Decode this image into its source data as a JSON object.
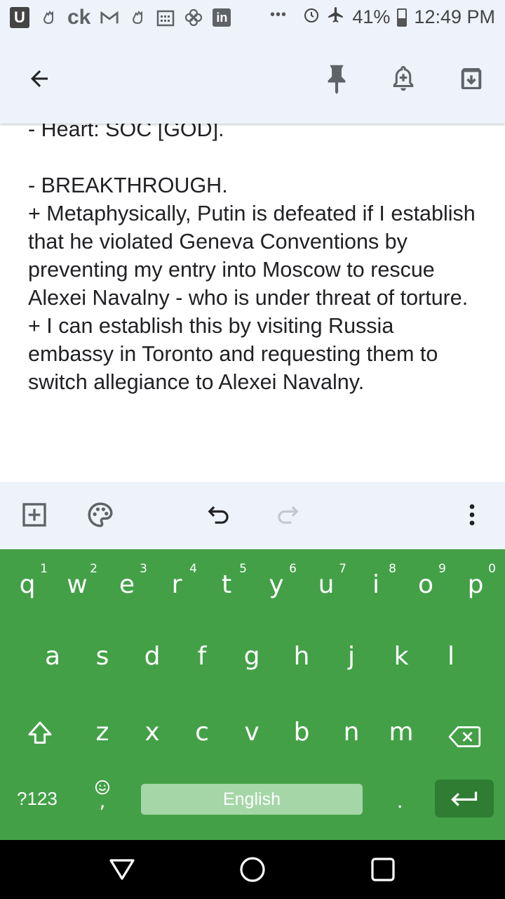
{
  "status_bar": {
    "app_letter": "U",
    "left_text": "ck",
    "right_icons": [
      "alarm-icon",
      "airplane-icon",
      "battery-icon"
    ],
    "battery": "41%",
    "time": "12:49 PM",
    "overflow": "•••"
  },
  "app_bar": {
    "back": "arrow-back-icon",
    "actions": [
      "pin-icon",
      "reminder-bell-icon",
      "archive-icon"
    ]
  },
  "note": {
    "lines": [
      "- Heart: SOC [GOD].",
      "",
      "- BREAKTHROUGH.",
      "+ Metaphysically, Putin is defeated if I establish that he violated Geneva Conventions by preventing my entry into Moscow to rescue Alexei Navalny - who is under threat of torture.",
      "+ I can establish this by visiting Russia embassy in Toronto and requesting them to switch allegiance to Alexei Navalny."
    ]
  },
  "editor_toolbar": {
    "tools": [
      "add-box-icon",
      "palette-icon",
      "undo-icon",
      "redo-icon",
      "more-vert-icon"
    ]
  },
  "keyboard": {
    "row1": [
      {
        "key": "q",
        "hint": "1"
      },
      {
        "key": "w",
        "hint": "2"
      },
      {
        "key": "e",
        "hint": "3"
      },
      {
        "key": "r",
        "hint": "4"
      },
      {
        "key": "t",
        "hint": "5"
      },
      {
        "key": "y",
        "hint": "6"
      },
      {
        "key": "u",
        "hint": "7"
      },
      {
        "key": "i",
        "hint": "8"
      },
      {
        "key": "o",
        "hint": "9"
      },
      {
        "key": "p",
        "hint": "0"
      }
    ],
    "row2": [
      "a",
      "s",
      "d",
      "f",
      "g",
      "h",
      "j",
      "k",
      "l"
    ],
    "row3": [
      "z",
      "x",
      "c",
      "v",
      "b",
      "n",
      "m"
    ],
    "symbols_label": "?123",
    "comma": ",",
    "space_label": "English",
    "period": ".",
    "colors": {
      "background": "#43a047",
      "space": "#a5d6a7",
      "enter": "#2e7d32"
    }
  },
  "nav_bar": {
    "buttons": [
      "back-triangle-icon",
      "home-circle-icon",
      "recents-square-icon"
    ]
  }
}
